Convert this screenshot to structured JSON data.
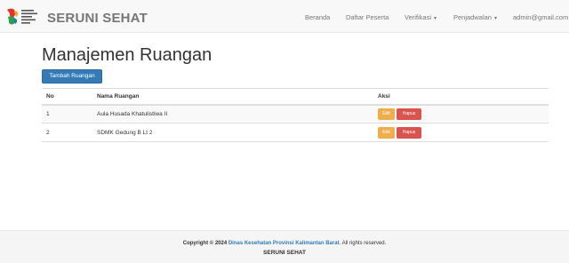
{
  "navbar": {
    "brand": "SERUNI SEHAT",
    "items": [
      {
        "label": "Beranda"
      },
      {
        "label": "Daftar Peserta"
      },
      {
        "label": "Verifikasi"
      },
      {
        "label": "Penjadwalan"
      },
      {
        "label": "admin@gmail.com"
      }
    ]
  },
  "page": {
    "title": "Manajemen Ruangan",
    "add_button": "Tambah Ruangan"
  },
  "table": {
    "headers": [
      "No",
      "Nama Ruangan",
      "Aksi"
    ],
    "rows": [
      {
        "no": "1",
        "name": "Aula Husada Khatulistiwa II",
        "edit": "Edit",
        "delete": "Hapus"
      },
      {
        "no": "2",
        "name": "SDMK Gedung B Lt 2",
        "edit": "Edit",
        "delete": "Hapus"
      }
    ]
  },
  "footer": {
    "copyright_prefix": "Copyright © 2024",
    "org_link": "Dinas Kesehatan Provinsi Kalimantan Barat",
    "rights": ". All rights reserved.",
    "app_name": "SERUNI SEHAT"
  },
  "colors": {
    "primary": "#337ab7",
    "warning": "#f0ad4e",
    "danger": "#d9534f"
  }
}
